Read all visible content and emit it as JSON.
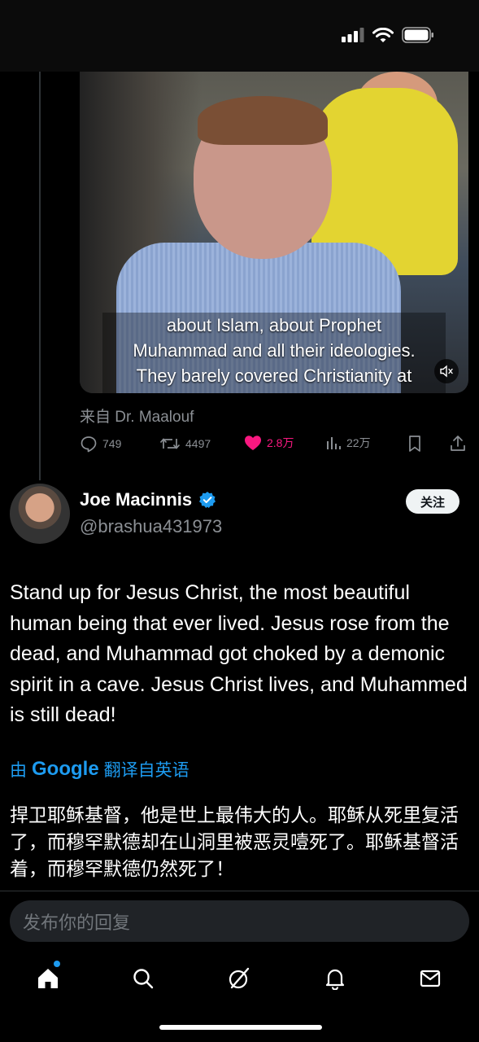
{
  "status_bar": {
    "icons": [
      "signal-icon",
      "wifi-icon",
      "battery-icon"
    ]
  },
  "media": {
    "caption_lines": [
      "about Islam, about Prophet",
      "Muhammad and all their ideologies.",
      "They barely covered Christianity at"
    ],
    "mute_icon": "mute-icon"
  },
  "source_text": "来自 Dr. Maalouf",
  "actions": {
    "replies": "749",
    "reposts": "4497",
    "likes": "2.8万",
    "views": "22万"
  },
  "author": {
    "name": "Joe Macinnis",
    "handle": "@brashua431973",
    "verified": true
  },
  "follow_label": "关注",
  "post_text": "Stand up for Jesus Christ, the most beautiful human being that ever lived. Jesus rose from the dead, and Muhammad got choked by a demonic spirit in a cave. Jesus Christ lives, and Muhammed is still dead!",
  "translation": {
    "by": "由",
    "provider": "Google",
    "label": "翻译自英语"
  },
  "translated_text": "捍卫耶稣基督，他是世上最伟大的人。耶稣从死里复活了，而穆罕默德却在山洞里被恶灵噎死了。耶稣基督活着，而穆罕默德仍然死了！",
  "reply_placeholder": "发布你的回复",
  "colors": {
    "accent": "#1d9bf0",
    "like": "#f91880",
    "muted": "#8b8f94"
  },
  "tabs": [
    "home-icon",
    "search-icon",
    "grok-icon",
    "notifications-icon",
    "messages-icon"
  ]
}
